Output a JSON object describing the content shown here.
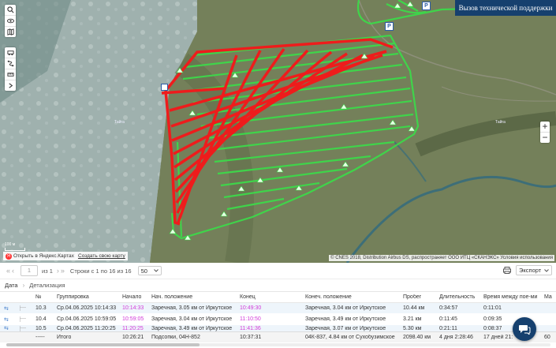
{
  "map": {
    "support_button": "Вызов технической поддержки",
    "zoom_in": "+",
    "zoom_out": "−",
    "scale_label": "100 м",
    "open_yandex": "Открыть в Яндекс.Картах",
    "create_map": "Создать свою карту",
    "copyright": "© CNES 2018, Distribution Airbus DS, распространяет ООО ИТЦ «СКАНЭКС» Условия использования",
    "parking_label": "P",
    "place_labels": [
      "Тайга",
      "Тайга"
    ],
    "colors": {
      "track_green": "#3dd94a",
      "track_red": "#ee1c1c",
      "support_bg": "#16406e"
    }
  },
  "pager": {
    "page_value": "1",
    "of_label": "из 1",
    "rows_label": "Строки с 1 по 16 из 16",
    "per_page": "50",
    "export_label": "Экспорт"
  },
  "tabs": [
    "Дата",
    "Детализация"
  ],
  "table": {
    "headers": [
      "№",
      "Группировка",
      "Начало",
      "Нач. положение",
      "Конец",
      "Конеч. положение",
      "Пробег",
      "Длительность",
      "Время между пое-ми",
      "Ма"
    ],
    "rows": [
      {
        "num": "10.3",
        "group": "Ср.04.06.2025 10:14:33",
        "start": "10:14:33",
        "start_pos": "Заречная, 3.05 км от Иркутское",
        "end": "10:49:30",
        "end_pos": "Заречная, 3.04 км от Иркутское",
        "mileage": "10.44 км",
        "duration": "0:34:57",
        "between": "0:11:01"
      },
      {
        "num": "10.4",
        "group": "Ср.04.06.2025 10:59:05",
        "start": "10:59:05",
        "start_pos": "Заречная, 3.04 км от Иркутское",
        "end": "11:10:50",
        "end_pos": "Заречная, 3.49 км от Иркутское",
        "mileage": "3.21 км",
        "duration": "0:11:45",
        "between": "0:09:35"
      },
      {
        "num": "10.5",
        "group": "Ср.04.06.2025 11:20:25",
        "start": "11:20:25",
        "start_pos": "Заречная, 3.49 км от Иркутское",
        "end": "11:41:36",
        "end_pos": "Заречная, 3.07 км от Иркутское",
        "mileage": "5.30 км",
        "duration": "0:21:11",
        "between": "0:08:37"
      }
    ],
    "total": {
      "num": "-----",
      "group": "Итого",
      "start": "10:26:21",
      "start_pos": "Подсопки, 04Н-852",
      "end": "10:37:31",
      "end_pos": "04К-837, 4.84 км от Сухобузимское",
      "mileage": "2098.40 км",
      "duration": "4 дня 2:28:46",
      "between": "17 дней 21:",
      "extra": "60"
    }
  }
}
